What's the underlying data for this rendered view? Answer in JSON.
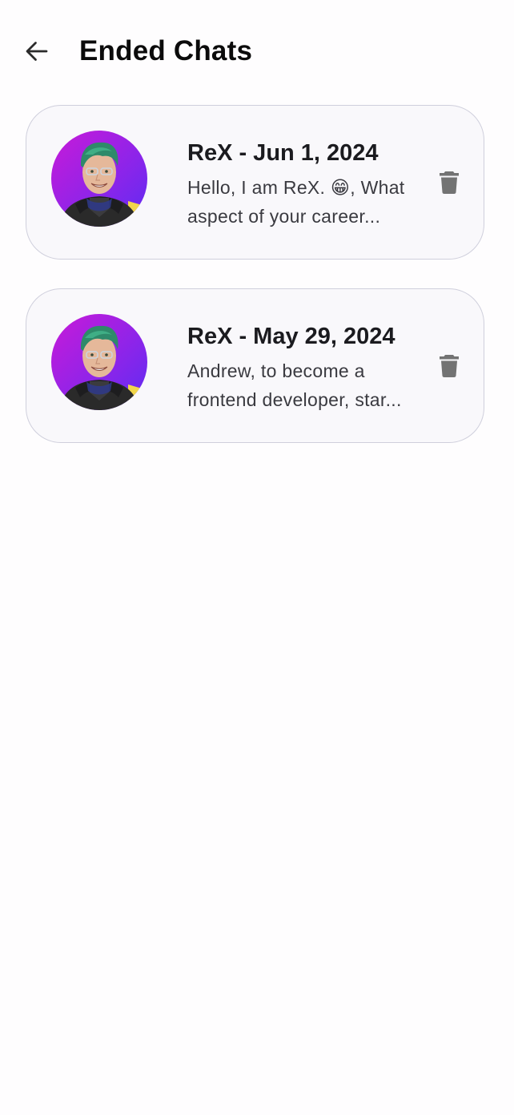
{
  "header": {
    "title": "Ended Chats",
    "back_icon": "arrow-left-icon"
  },
  "chats": [
    {
      "title": "ReX - Jun 1, 2024",
      "preview_line1": "Hello, I am ReX. 😁, What",
      "preview_line2": "aspect of your career...",
      "avatar_icon": "rex-avatar",
      "delete_icon": "trash-icon"
    },
    {
      "title": "ReX - May 29, 2024",
      "preview_line1": "Andrew, to become a",
      "preview_line2": "frontend developer, star...",
      "avatar_icon": "rex-avatar",
      "delete_icon": "trash-icon"
    }
  ],
  "colors": {
    "background": "#fefdfe",
    "card_background": "#f9f8fb",
    "card_border": "#cfcfdc",
    "icon_gray": "#737373",
    "avatar_gradient_start": "#c41de0",
    "avatar_gradient_end": "#6a2cf0"
  }
}
